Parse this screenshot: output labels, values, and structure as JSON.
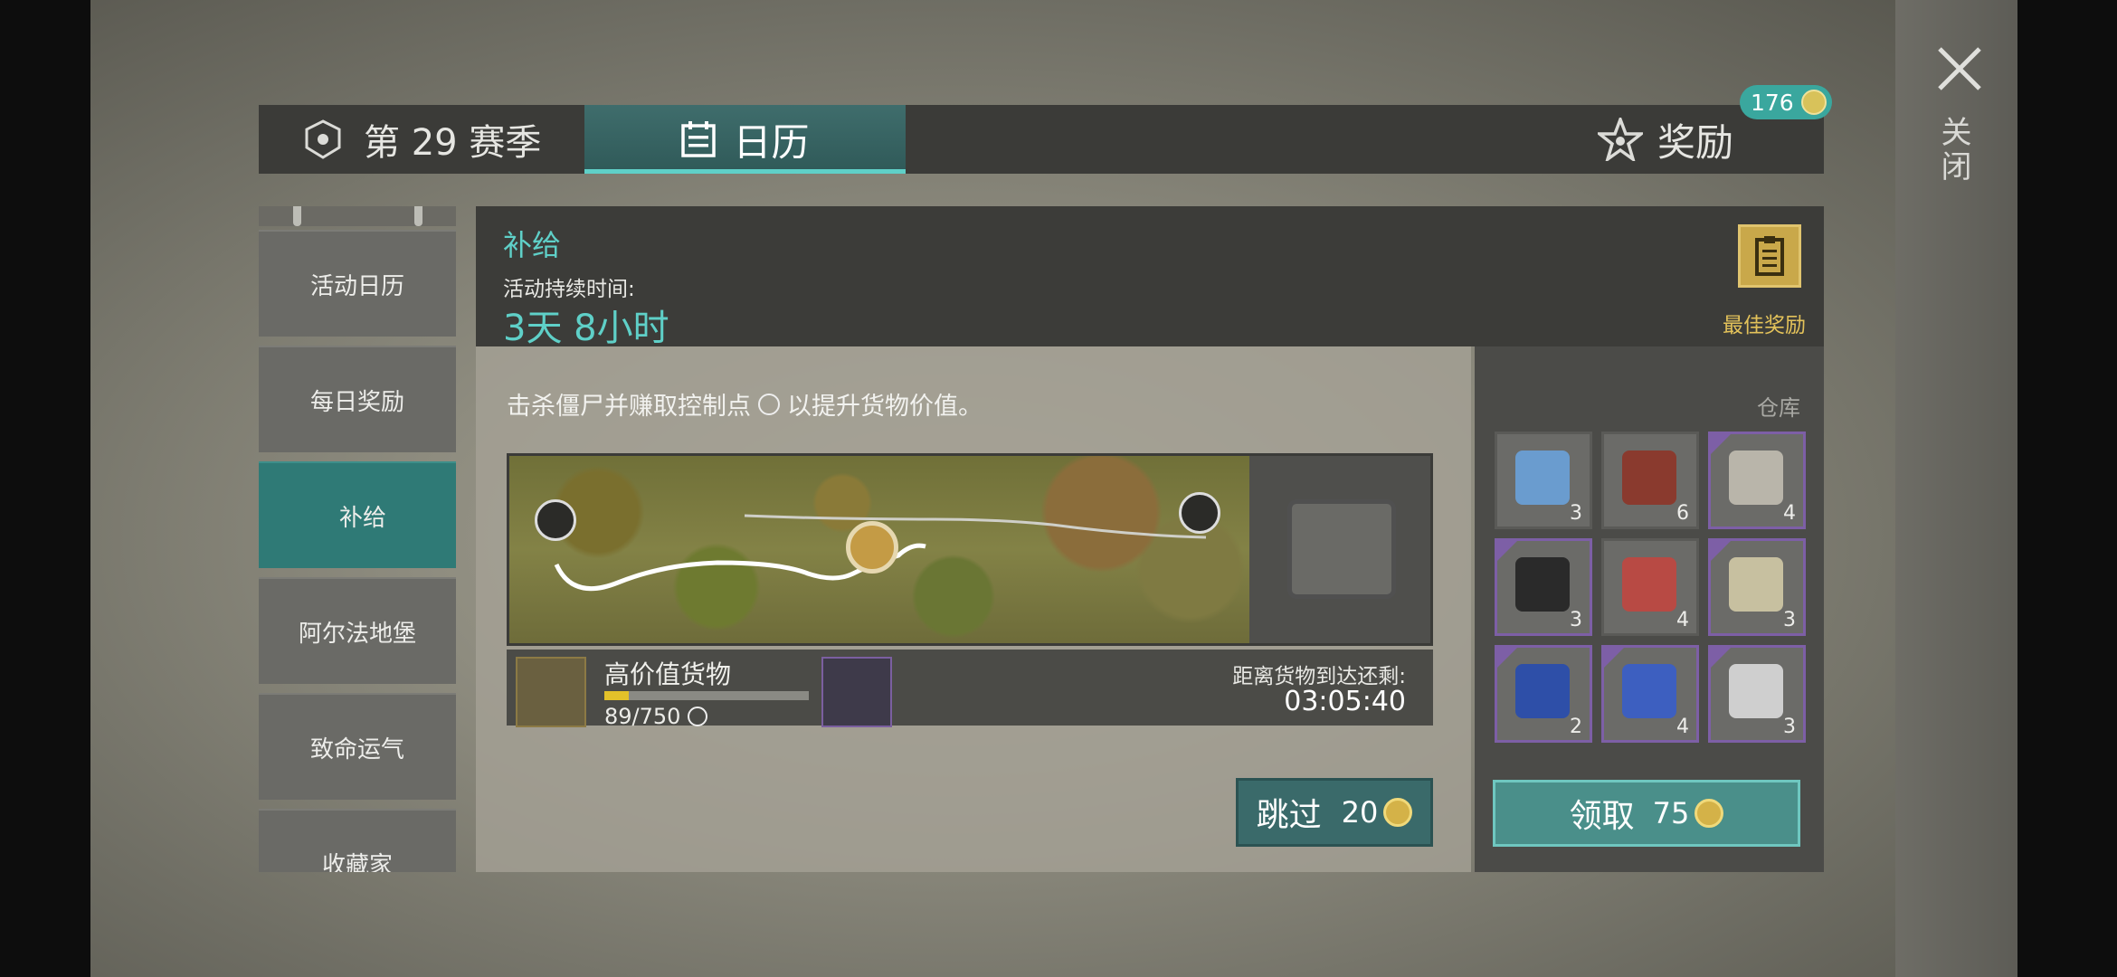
{
  "header_tabs": {
    "season_label": "第 29 赛季",
    "calendar_label": "日历",
    "reward_label": "奖励",
    "reward_badge": "176"
  },
  "close_label": "关闭",
  "sidebar": {
    "items": [
      {
        "label": "活动日历"
      },
      {
        "label": "每日奖励"
      },
      {
        "label": "补给"
      },
      {
        "label": "阿尔法地堡"
      },
      {
        "label": "致命运气"
      },
      {
        "label": "收藏家"
      }
    ],
    "active_index": 2
  },
  "event": {
    "title": "补给",
    "duration_label": "活动持续时间:",
    "duration_value": "3天 8小时",
    "best_reward_label": "最佳奖励",
    "description_before": "击杀僵尸并赚取控制点",
    "description_after": "以提升货物价值。"
  },
  "cargo": {
    "name": "高价值货物",
    "progress_text": "89/750",
    "progress_fraction": 0.119,
    "eta_label": "距离货物到达还剩:",
    "eta_value": "03:05:40"
  },
  "skip_button": {
    "label": "跳过",
    "cost": "20"
  },
  "warehouse": {
    "label": "仓库",
    "items": [
      {
        "icon": "water-bottle-icon",
        "qty": "3",
        "rare": false,
        "color": "#6a9ccf"
      },
      {
        "icon": "bacon-icon",
        "qty": "6",
        "rare": false,
        "color": "#8a3a2e"
      },
      {
        "icon": "skull-gear-icon",
        "qty": "4",
        "rare": true,
        "color": "#b9b5aa"
      },
      {
        "icon": "coal-pile-icon",
        "qty": "3",
        "rare": true,
        "color": "#2a2a2a"
      },
      {
        "icon": "steak-icon",
        "qty": "4",
        "rare": false,
        "color": "#b84a44"
      },
      {
        "icon": "explosive-bar-icon",
        "qty": "3",
        "rare": true,
        "color": "#c7c0a0"
      },
      {
        "icon": "circuit-board-icon",
        "qty": "2",
        "rare": true,
        "color": "#2e4fa8"
      },
      {
        "icon": "dog-food-bag-icon",
        "qty": "4",
        "rare": true,
        "color": "#3d5fc0"
      },
      {
        "icon": "scrap-metal-icon",
        "qty": "3",
        "rare": true,
        "color": "#cfcfcf"
      }
    ]
  },
  "claim_button": {
    "label": "领取",
    "cost": "75"
  }
}
